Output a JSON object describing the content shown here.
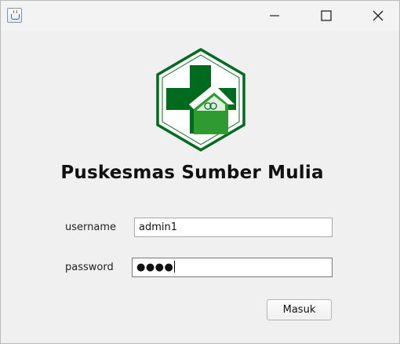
{
  "window": {
    "icon": "java-cup-icon",
    "controls": [
      "minimize-icon",
      "maximize-icon",
      "close-icon"
    ]
  },
  "logo": {
    "icon": "puskesmas-logo",
    "colors": {
      "green": "#006b1e",
      "light_green": "#2f9a2f",
      "white": "#ffffff"
    }
  },
  "login": {
    "title": "Puskesmas Sumber Mulia",
    "username_label": "username",
    "username_value": "admin1",
    "password_label": "password",
    "password_mask": "●●●●",
    "submit_label": "Masuk"
  }
}
